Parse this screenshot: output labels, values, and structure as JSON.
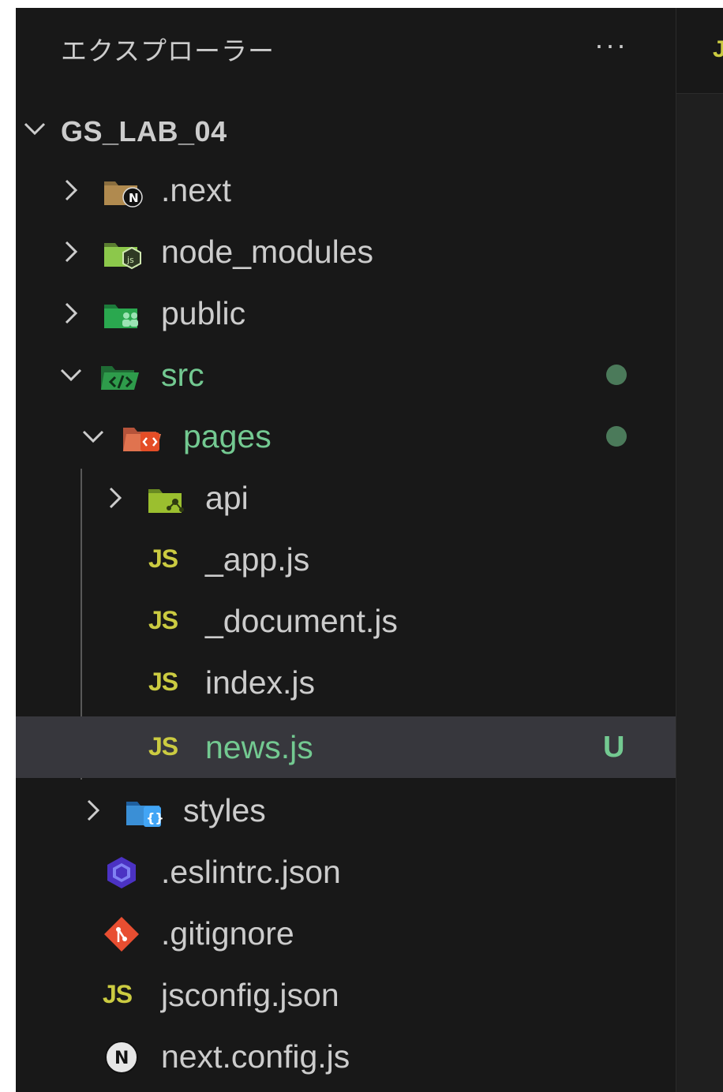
{
  "explorer": {
    "title": "エクスプローラー",
    "more_label": "···"
  },
  "editor": {
    "tab_glyph": "J"
  },
  "tree": {
    "root": "GS_LAB_04",
    "items": [
      {
        "label": ".next",
        "icon": "folder-next-icon"
      },
      {
        "label": "node_modules",
        "icon": "folder-node-icon"
      },
      {
        "label": "public",
        "icon": "folder-public-icon"
      },
      {
        "label": "src",
        "icon": "folder-src-icon",
        "status": "modified"
      },
      {
        "label": "pages",
        "icon": "folder-pages-icon",
        "status": "modified"
      },
      {
        "label": "api",
        "icon": "folder-api-icon"
      },
      {
        "label": "_app.js",
        "icon": "js-file-icon",
        "glyph": "JS"
      },
      {
        "label": "_document.js",
        "icon": "js-file-icon",
        "glyph": "JS"
      },
      {
        "label": "index.js",
        "icon": "js-file-icon",
        "glyph": "JS"
      },
      {
        "label": "news.js",
        "icon": "js-file-icon",
        "glyph": "JS",
        "badge": "U",
        "selected": true
      },
      {
        "label": "styles",
        "icon": "folder-styles-icon"
      },
      {
        "label": ".eslintrc.json",
        "icon": "eslint-icon"
      },
      {
        "label": ".gitignore",
        "icon": "git-icon"
      },
      {
        "label": "jsconfig.json",
        "icon": "jsconfig-icon",
        "glyph": "JS"
      },
      {
        "label": "next.config.js",
        "icon": "nextjs-icon"
      }
    ]
  },
  "colors": {
    "background": "#181818",
    "selected_row": "#37373d",
    "untracked_green": "#73c991",
    "js_yellow": "#cbcb41",
    "modified_dot": "#4b7a5a"
  }
}
